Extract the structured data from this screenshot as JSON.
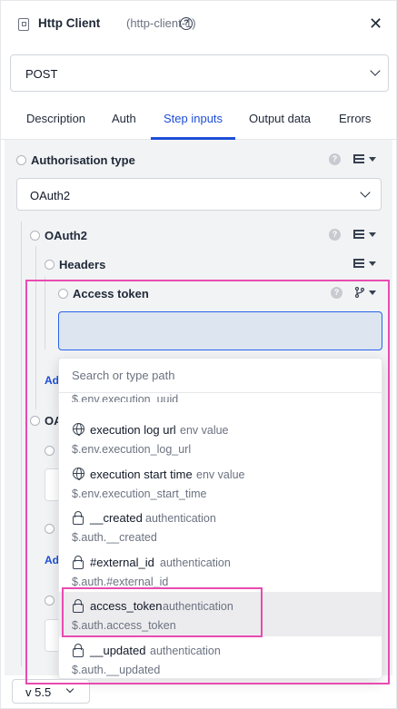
{
  "header": {
    "title": "Http Client",
    "subtitle": "(http-client-1)",
    "help_icon": "question-circle-icon",
    "close_icon": "close-icon"
  },
  "method": {
    "value": "POST"
  },
  "tabs": [
    {
      "label": "Description"
    },
    {
      "label": "Auth"
    },
    {
      "label": "Step inputs",
      "active": true
    },
    {
      "label": "Output data"
    },
    {
      "label": "Errors"
    }
  ],
  "fields": {
    "authorisation_type": {
      "label": "Authorisation type",
      "value": "OAuth2"
    },
    "oauth2": {
      "label": "OAuth2"
    },
    "headers": {
      "label": "Headers"
    },
    "access_token": {
      "label": "Access token"
    }
  },
  "partial_labels": {
    "add_1": "Ad",
    "oauth_2": "OA",
    "add_2": "Ad"
  },
  "dropdown": {
    "search_placeholder": "Search or type path",
    "cut_path": "$.env.execution_uuid",
    "options": [
      {
        "name": "execution log url",
        "kind": "env value",
        "path": "$.env.execution_log_url",
        "icon": "globe-icon"
      },
      {
        "name": "execution start time",
        "kind": "env value",
        "path": "$.env.execution_start_time",
        "icon": "globe-icon"
      },
      {
        "name": "__created",
        "kind": "authentication",
        "path": "$.auth.__created",
        "icon": "lock-icon"
      },
      {
        "name": "#external_id",
        "kind": "authentication",
        "path": "$.auth.#external_id",
        "icon": "lock-icon"
      },
      {
        "name": "access_token",
        "kind": "authentication",
        "path": "$.auth.access_token",
        "icon": "lock-icon",
        "highlighted": true
      },
      {
        "name": "__updated",
        "kind": "authentication",
        "path": "$.auth.__updated",
        "icon": "lock-icon"
      }
    ]
  },
  "footer": {
    "version": "v 5.5"
  },
  "colors": {
    "accent": "#1d4ed8",
    "highlight_border": "#e94bb0",
    "input_focus_bg": "#dde5f1",
    "content_bg": "#f2f3f5"
  }
}
